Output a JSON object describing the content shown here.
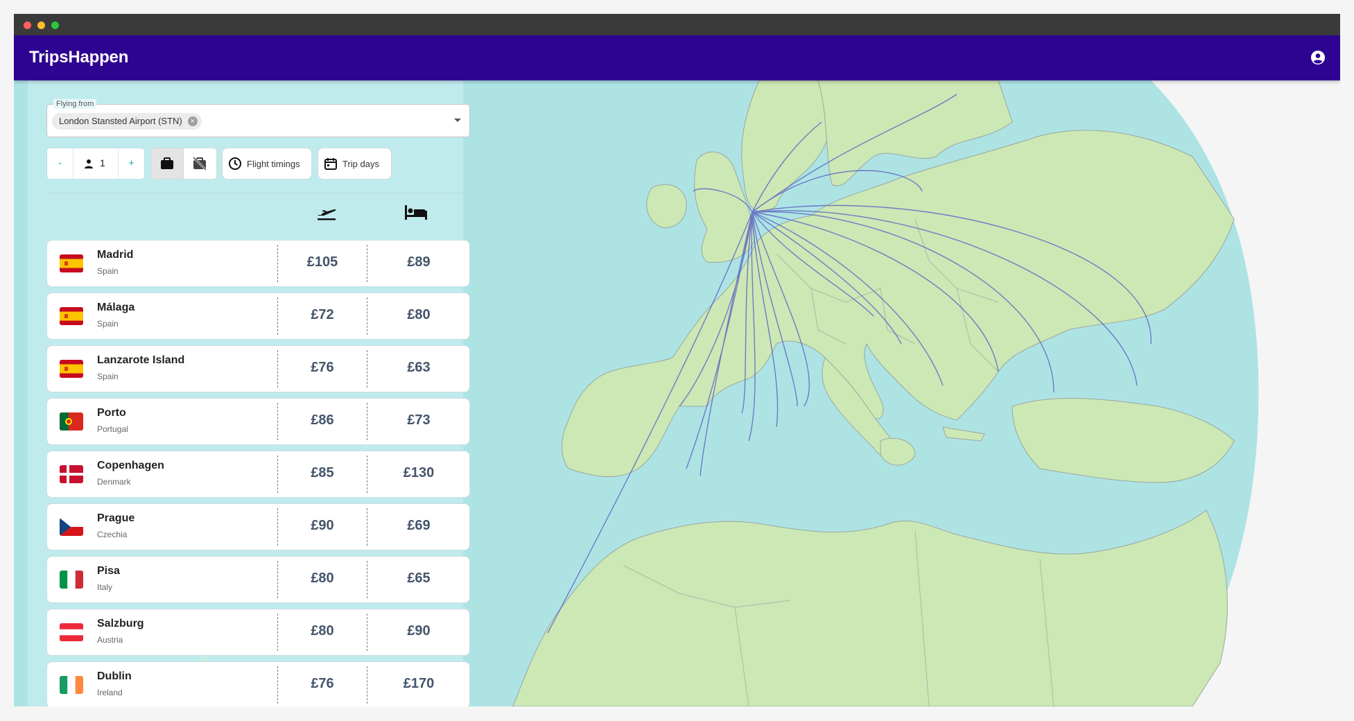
{
  "app": {
    "title": "TripsHappen"
  },
  "search": {
    "from_label": "Flying from",
    "from_value": "London Stansted Airport (STN)",
    "passengers_minus": "-",
    "passengers_plus": "+",
    "passengers_count": "1",
    "flight_timings_label": "Flight timings",
    "trip_days_label": "Trip days"
  },
  "icons": {
    "account": "account-circle-icon",
    "person": "person-icon",
    "bag": "luggage-icon",
    "no_bag": "no-luggage-icon",
    "clock": "clock-icon",
    "calendar": "calendar-icon",
    "flight_column": "flight-takeoff-icon",
    "hotel_column": "hotel-bed-icon"
  },
  "colors": {
    "app_bar": "#2e0391",
    "sea": "#aee3e4",
    "land": "#cce8b5",
    "route": "#6b6bbf",
    "price_text": "#44546a"
  },
  "destinations": [
    {
      "city": "Madrid",
      "country": "Spain",
      "flight_price": "£105",
      "hotel_price": "£89",
      "flag": "es"
    },
    {
      "city": "Málaga",
      "country": "Spain",
      "flight_price": "£72",
      "hotel_price": "£80",
      "flag": "es"
    },
    {
      "city": "Lanzarote Island",
      "country": "Spain",
      "flight_price": "£76",
      "hotel_price": "£63",
      "flag": "es"
    },
    {
      "city": "Porto",
      "country": "Portugal",
      "flight_price": "£86",
      "hotel_price": "£73",
      "flag": "pt"
    },
    {
      "city": "Copenhagen",
      "country": "Denmark",
      "flight_price": "£85",
      "hotel_price": "£130",
      "flag": "dk"
    },
    {
      "city": "Prague",
      "country": "Czechia",
      "flight_price": "£90",
      "hotel_price": "£69",
      "flag": "cz"
    },
    {
      "city": "Pisa",
      "country": "Italy",
      "flight_price": "£80",
      "hotel_price": "£65",
      "flag": "it"
    },
    {
      "city": "Salzburg",
      "country": "Austria",
      "flight_price": "£80",
      "hotel_price": "£90",
      "flag": "at"
    },
    {
      "city": "Dublin",
      "country": "Ireland",
      "flight_price": "£76",
      "hotel_price": "£170",
      "flag": "ie"
    }
  ]
}
